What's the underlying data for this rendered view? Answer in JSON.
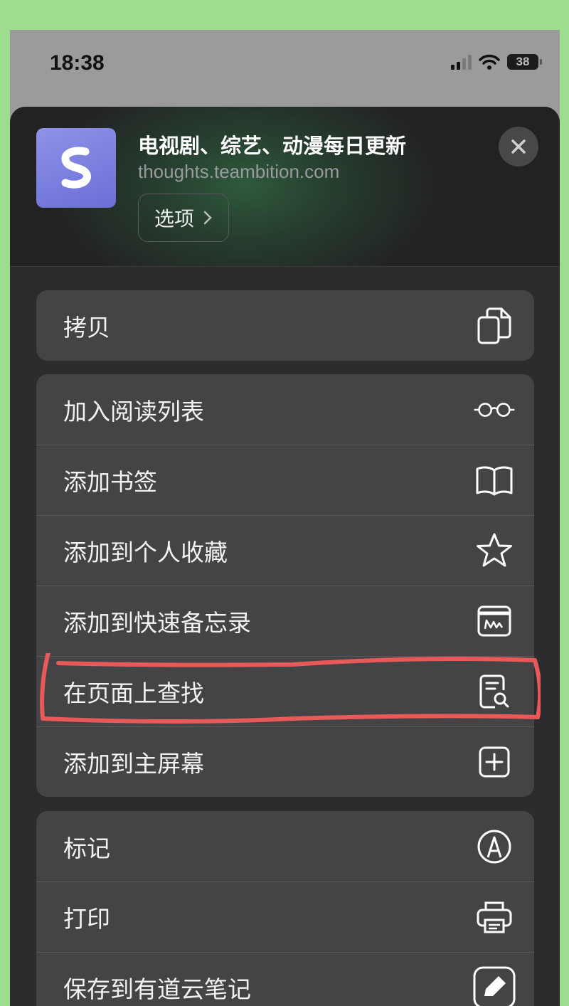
{
  "status_bar": {
    "time": "18:38",
    "battery": "38"
  },
  "sheet": {
    "title": "电视剧、综艺、动漫每日更新",
    "url": "thoughts.teambition.com",
    "options_label": "选项"
  },
  "groups": [
    {
      "items": [
        {
          "label": "拷贝",
          "icon": "copy-icon"
        }
      ]
    },
    {
      "items": [
        {
          "label": "加入阅读列表",
          "icon": "glasses-icon"
        },
        {
          "label": "添加书签",
          "icon": "book-icon"
        },
        {
          "label": "添加到个人收藏",
          "icon": "star-icon"
        },
        {
          "label": "添加到快速备忘录",
          "icon": "quick-note-icon"
        },
        {
          "label": "在页面上查找",
          "icon": "find-in-page-icon"
        },
        {
          "label": "添加到主屏幕",
          "icon": "plus-square-icon"
        }
      ]
    },
    {
      "items": [
        {
          "label": "标记",
          "icon": "markup-icon"
        },
        {
          "label": "打印",
          "icon": "printer-icon"
        },
        {
          "label": "保存到有道云笔记",
          "icon": "youdao-note-icon"
        }
      ]
    }
  ],
  "colors": {
    "background": "#9edc8e",
    "sheet": "#2c2c2e",
    "group": "#444446",
    "highlight": "#e85a5a",
    "app_icon": "#7f82e0"
  }
}
